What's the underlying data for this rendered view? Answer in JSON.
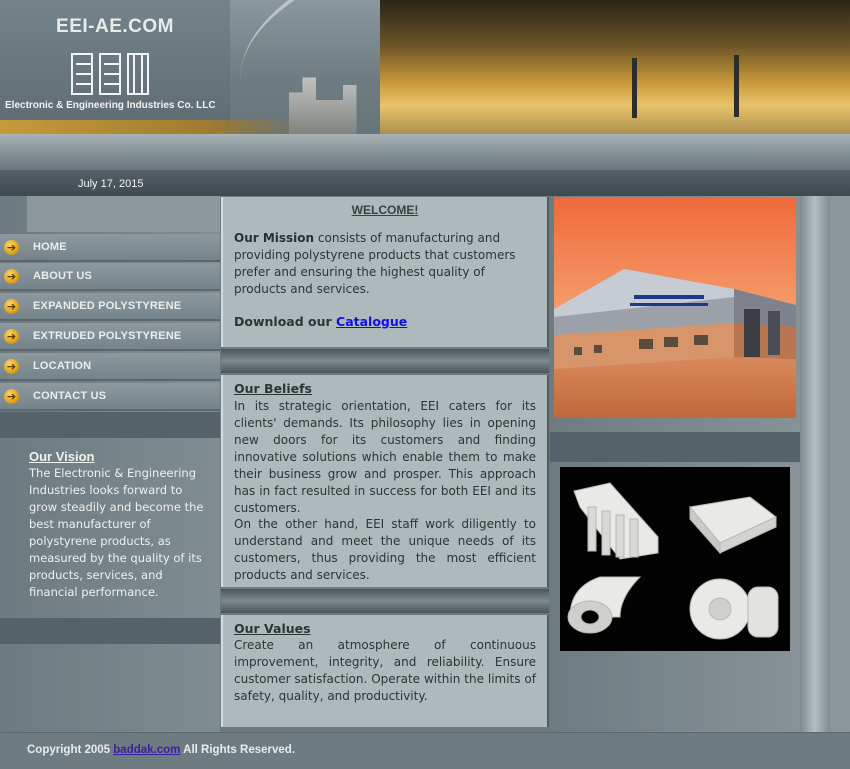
{
  "header": {
    "site_name": "EEI-AE.COM",
    "company_name": "Electronic & Engineering Industries Co. LLC",
    "date": "July 17, 2015"
  },
  "nav": {
    "items": [
      {
        "label": "HOME"
      },
      {
        "label": "ABOUT US"
      },
      {
        "label": "EXPANDED POLYSTYRENE"
      },
      {
        "label": "EXTRUDED POLYSTYRENE"
      },
      {
        "label": "LOCATION"
      },
      {
        "label": "CONTACT US"
      }
    ],
    "icon": "arrow-right-icon"
  },
  "vision": {
    "title": "Our Vision",
    "text": "The Electronic & Engineering Industries looks forward to grow steadily and become the best manufacturer of polystyrene products, as measured by the quality of its products, services, and financial performance."
  },
  "main": {
    "welcome": "WELCOME!",
    "mission_lead": "Our Mission",
    "mission_text": " consists of manufacturing and providing polystyrene products that customers prefer and ensuring the highest quality of products and services.",
    "download_prefix": "Download our ",
    "catalogue_link": "Catalogue",
    "beliefs_title": "Our Beliefs",
    "beliefs_p1": "In its strategic orientation, EEI caters for its clients' demands. Its philosophy lies in opening new doors for its customers and finding innovative solutions which enable them to make their business grow and prosper. This approach has in fact resulted in success for both EEI and its customers.",
    "beliefs_p2": "On the other hand, EEI staff work diligently to understand and meet the unique needs of its customers, thus providing the most efficient products and services.",
    "values_title": "Our Values",
    "values_text": "Create an atmosphere of continuous improvement, integrity, and reliability. Ensure customer satisfaction. Operate within the limits of safety, quality, and productivity."
  },
  "footer": {
    "prefix": "Copyright 2005 ",
    "link": "baddak.com",
    "suffix": " All Rights Reserved."
  },
  "colors": {
    "link": "#1010e0",
    "nav_icon": "#e0a21a",
    "panel": "#aeb9bb"
  }
}
